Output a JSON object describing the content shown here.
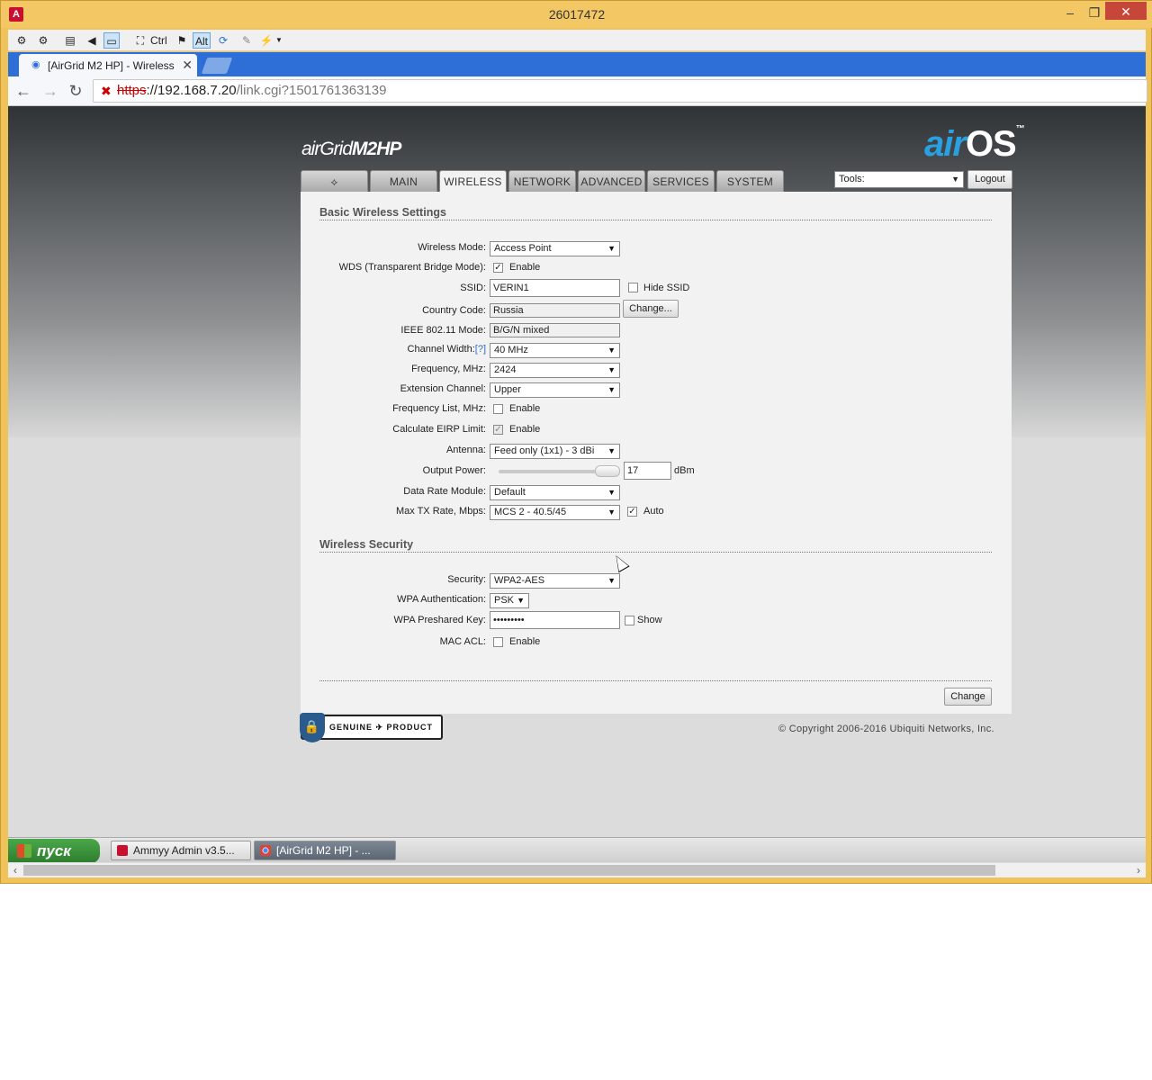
{
  "window": {
    "title": "26017472",
    "minimize": "‒",
    "maximize": "❐",
    "close": "✕"
  },
  "ammyy_toolbar": {
    "ctrl_label": "Ctrl",
    "alt_label": "Alt"
  },
  "browser": {
    "tab_title": "[AirGrid M2 HP] - Wireless",
    "tab_close": "✕",
    "url_scheme": "https",
    "url_host": "://192.168.7.20",
    "url_path": "/link.cgi?1501761363139"
  },
  "header": {
    "product_logo_prefix": "airGrid",
    "product_logo_model": "M2HP",
    "os_logo_air": "air",
    "os_logo_os": "OS",
    "os_logo_tm": "™",
    "tabs": [
      {
        "label": ""
      },
      {
        "label": "MAIN"
      },
      {
        "label": "WIRELESS"
      },
      {
        "label": "NETWORK"
      },
      {
        "label": "ADVANCED"
      },
      {
        "label": "SERVICES"
      },
      {
        "label": "SYSTEM"
      }
    ],
    "tools_value": "Tools:",
    "logout_label": "Logout"
  },
  "basic": {
    "section_title": "Basic Wireless Settings",
    "wireless_mode_label": "Wireless Mode:",
    "wireless_mode_value": "Access Point",
    "wds_label": "WDS (Transparent Bridge Mode):",
    "wds_option": "Enable",
    "ssid_label": "SSID:",
    "ssid_value": "VERIN1",
    "hide_ssid_label": "Hide SSID",
    "country_label": "Country Code:",
    "country_value": "Russia",
    "change_country_label": "Change...",
    "ieee_label": "IEEE 802.11 Mode:",
    "ieee_value": "B/G/N mixed",
    "channel_width_label": "Channel Width:",
    "channel_width_help": "[?]",
    "channel_width_value": "40 MHz",
    "frequency_label": "Frequency, MHz:",
    "frequency_value": "2424",
    "extension_label": "Extension Channel:",
    "extension_value": "Upper",
    "freq_list_label": "Frequency List, MHz:",
    "freq_list_option": "Enable",
    "eirp_label": "Calculate EIRP Limit:",
    "eirp_option": "Enable",
    "antenna_label": "Antenna:",
    "antenna_value": "Feed only (1x1) - 3 dBi",
    "output_power_label": "Output Power:",
    "output_power_value": "17",
    "output_power_unit": "dBm",
    "data_rate_label": "Data Rate Module:",
    "data_rate_value": "Default",
    "max_tx_label": "Max TX Rate, Mbps:",
    "max_tx_value": "MCS 2 - 40.5/45",
    "max_tx_auto": "Auto"
  },
  "security": {
    "section_title": "Wireless Security",
    "security_label": "Security:",
    "security_value": "WPA2-AES",
    "wpa_auth_label": "WPA Authentication:",
    "wpa_auth_value": "PSK",
    "wpa_key_label": "WPA Preshared Key:",
    "wpa_key_value": "•••••••••",
    "show_label": "Show",
    "mac_acl_label": "MAC ACL:",
    "mac_acl_option": "Enable"
  },
  "footer": {
    "change_label": "Change",
    "genuine_label": "GENUINE ✈ PRODUCT",
    "copyright": "© Copyright 2006-2016 Ubiquiti Networks, Inc."
  },
  "taskbar": {
    "start_label": "пуск",
    "items": [
      {
        "label": "Ammyy Admin v3.5..."
      },
      {
        "label": "[AirGrid M2 HP] - ..."
      }
    ]
  },
  "colors": {
    "accent_blue": "#2d6fd6",
    "window_frame": "#f0c25a",
    "ammyy_red": "#c8102e"
  }
}
